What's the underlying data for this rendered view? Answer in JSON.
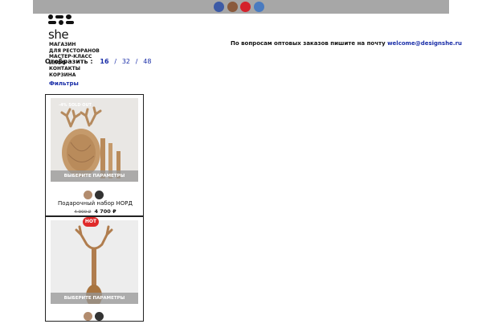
{
  "topbar": {
    "social_icons": [
      "facebook-icon",
      "vk-icon",
      "youtube-icon",
      "telegram-icon"
    ],
    "colors": [
      "#3c5aa6",
      "#8a5a3c",
      "#d4212b",
      "#4a7bc0"
    ]
  },
  "brand": {
    "logo_text": "she"
  },
  "menu": {
    "items": [
      "МАГАЗИН",
      "ДЛЯ РЕСТОРАНОВ",
      "МАСТЕР-КЛАСС",
      "ИНФО",
      "КОНТАКТЫ",
      "КОРЗИНА"
    ]
  },
  "contact": {
    "text": "По вопросам оптовых заказов пишите на почту",
    "email": "welcome@designshe.ru"
  },
  "show": {
    "label": "Отобразить :",
    "options": [
      "16",
      "32",
      "48"
    ],
    "active": "16"
  },
  "filters_label": "Фильтры",
  "products": [
    {
      "badge": "-4%  SOLD OUT",
      "params_label": "ВЫБЕРИТЕ ПАРАМЕТРЫ",
      "name": "Подарочный набор НОРД",
      "old_price": "4 900 ₽",
      "price": "4 700 ₽",
      "swatches": [
        "#b28c6e",
        "#333333"
      ]
    },
    {
      "badge": "HOT",
      "params_label": "ВЫБЕРИТЕ ПАРАМЕТРЫ",
      "swatches": [
        "#b28c6e",
        "#333333"
      ]
    }
  ]
}
